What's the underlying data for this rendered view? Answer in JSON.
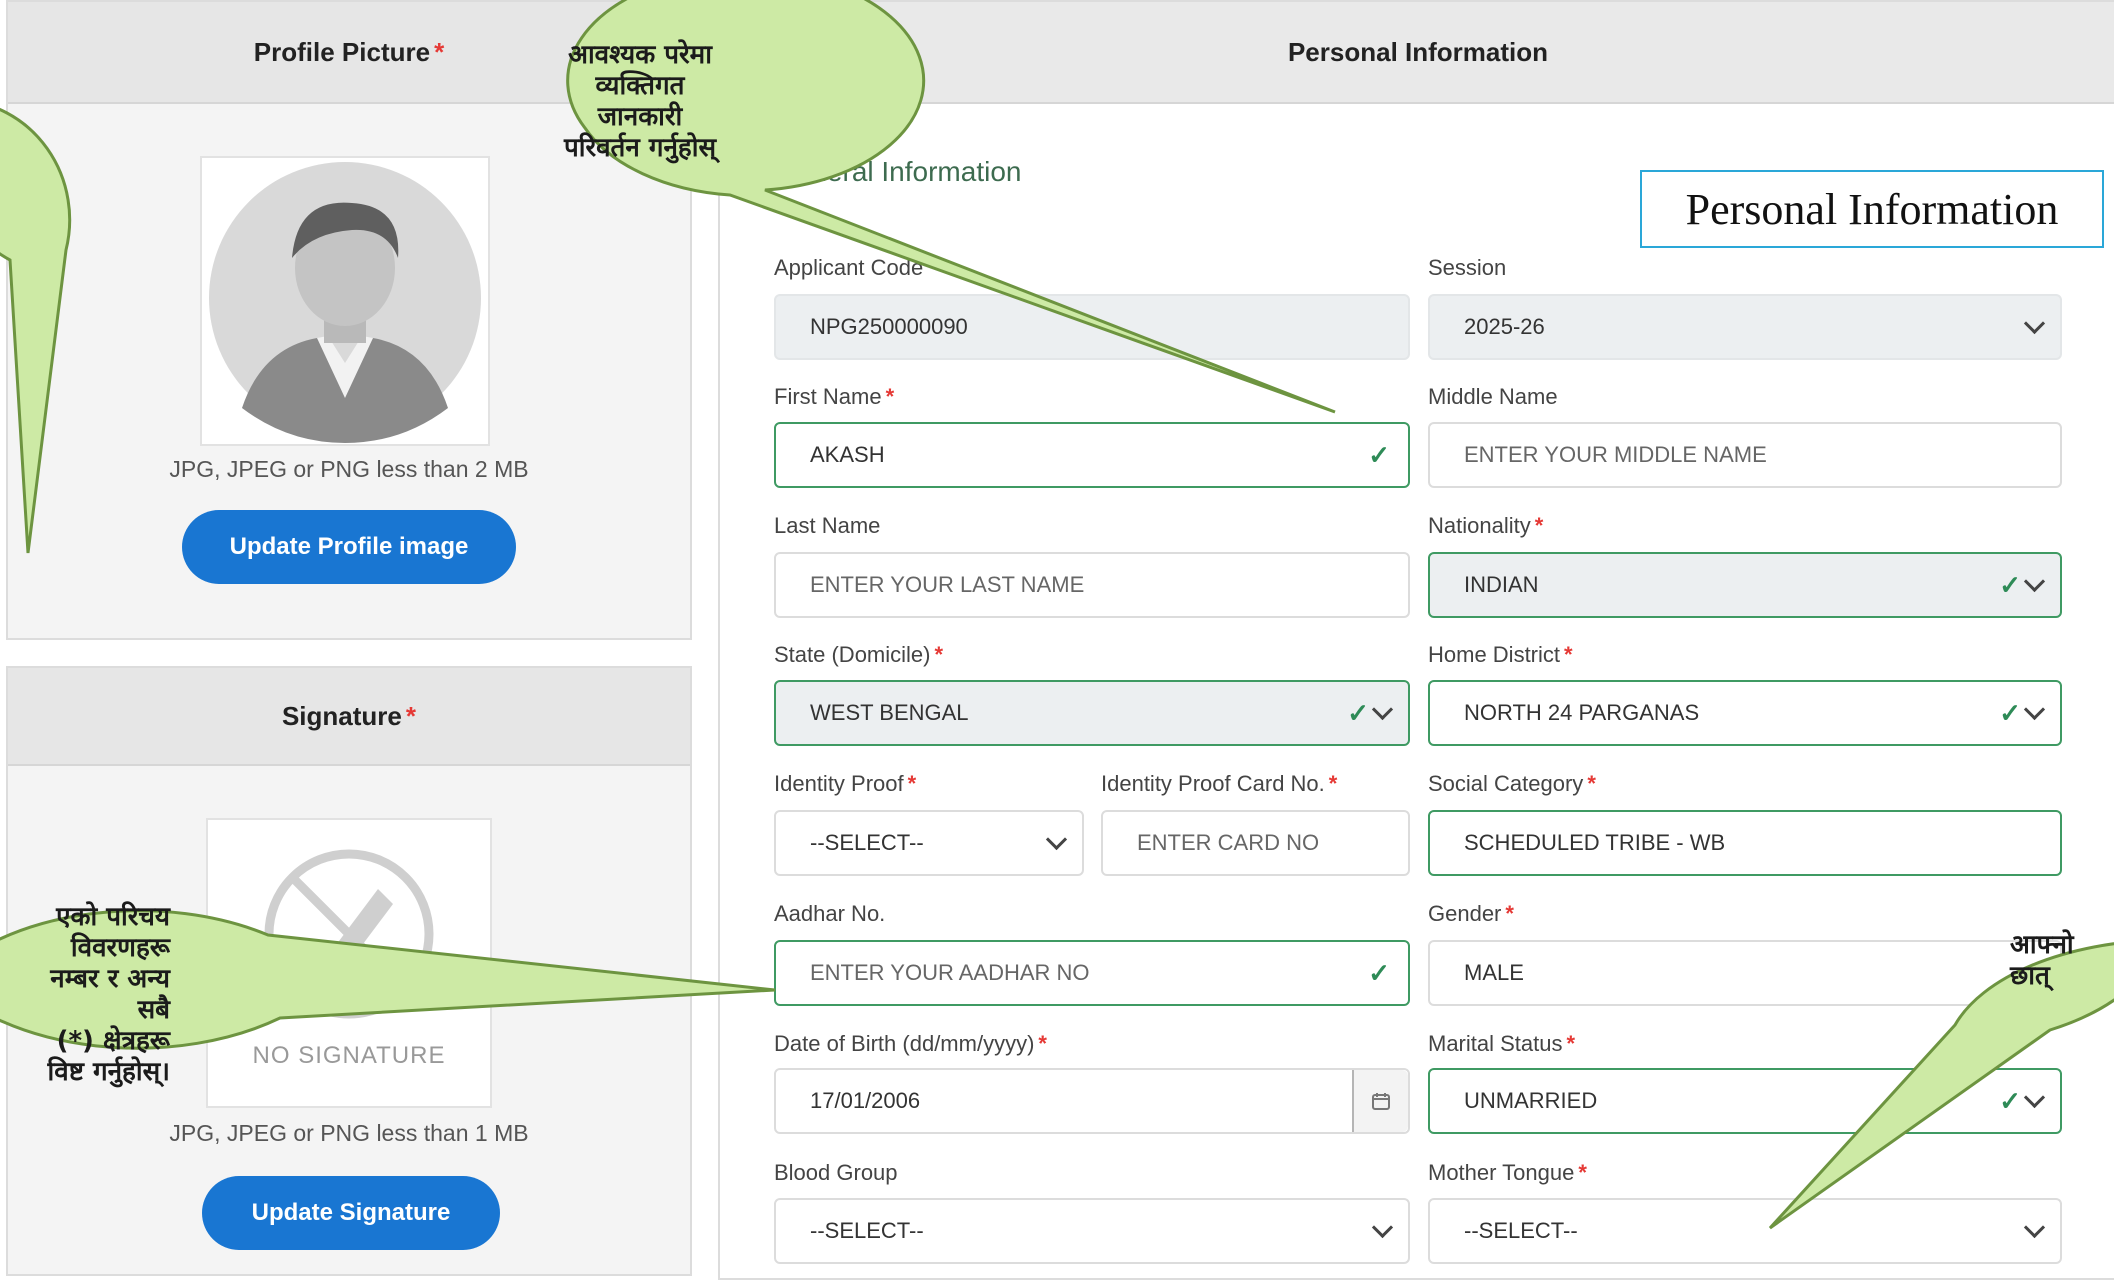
{
  "profile": {
    "title": "Profile Picture",
    "hint": "JPG, JPEG or PNG less than 2 MB",
    "button": "Update Profile image"
  },
  "signature": {
    "title": "Signature",
    "placeholder_text": "NO SIGNATURE",
    "hint": "JPG, JPEG or PNG less than 1 MB",
    "button": "Update Signature"
  },
  "personal": {
    "title": "Personal Information",
    "section": "General Information",
    "caption_box": "Personal Information"
  },
  "fields": {
    "applicant_code": {
      "label": "Applicant Code",
      "value": "NPG250000090"
    },
    "session": {
      "label": "Session",
      "value": "2025-26"
    },
    "first_name": {
      "label": "First Name",
      "value": "AKASH"
    },
    "middle_name": {
      "label": "Middle Name",
      "placeholder": "ENTER YOUR MIDDLE NAME"
    },
    "last_name": {
      "label": "Last Name",
      "placeholder": "ENTER YOUR LAST NAME"
    },
    "nationality": {
      "label": "Nationality",
      "value": "INDIAN"
    },
    "state": {
      "label": "State (Domicile)",
      "value": "WEST BENGAL"
    },
    "home_district": {
      "label": "Home District",
      "value": "NORTH 24 PARGANAS"
    },
    "identity_proof": {
      "label": "Identity Proof",
      "value": "--SELECT--"
    },
    "identity_card_no": {
      "label": "Identity Proof Card No.",
      "placeholder": "ENTER CARD NO"
    },
    "social_category": {
      "label": "Social Category",
      "value": "SCHEDULED TRIBE - WB"
    },
    "aadhar": {
      "label": "Aadhar No.",
      "placeholder": "ENTER YOUR AADHAR NO"
    },
    "gender": {
      "label": "Gender",
      "value": "MALE"
    },
    "dob": {
      "label": "Date of Birth (dd/mm/yyyy)",
      "value": "17/01/2006"
    },
    "marital_status": {
      "label": "Marital Status",
      "value": "UNMARRIED"
    },
    "blood_group": {
      "label": "Blood Group",
      "value": "--SELECT--"
    },
    "mother_tongue": {
      "label": "Mother Tongue",
      "value": "--SELECT--"
    }
  },
  "callouts": {
    "top": "आवश्यक परेमा\nव्यक्तिगत\nजानकारी\nपरिवर्तन गर्नुहोस्",
    "left": "एको परिचय\nविवरणहरू\nनम्बर र अन्य\nसबै\n(*) क्षेत्रहरू\nविष्ट गर्नुहोस्।",
    "right": "आफ्नो\nछात्"
  },
  "colors": {
    "callout_fill": "#cdeaa5",
    "callout_border": "#6d9440",
    "valid_border": "#3f9a63",
    "button_blue": "#1976d2",
    "required_star": "#e53935"
  }
}
